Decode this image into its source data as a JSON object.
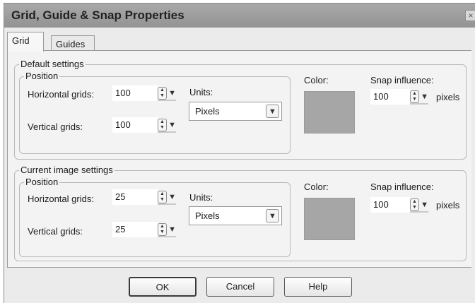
{
  "window": {
    "title": "Grid, Guide & Snap Properties",
    "close_glyph": "×"
  },
  "tabs": [
    {
      "label": "Grid",
      "active": true
    },
    {
      "label": "Guides",
      "active": false
    }
  ],
  "default_settings": {
    "group_label": "Default settings",
    "position_label": "Position",
    "horizontal_label": "Horizontal grids:",
    "horizontal_value": "100",
    "vertical_label": "Vertical grids:",
    "vertical_value": "100",
    "units_label": "Units:",
    "units_value": "Pixels",
    "color_label": "Color:",
    "color": "#a6a6a6",
    "snap_label": "Snap influence:",
    "snap_value": "100",
    "snap_unit": "pixels"
  },
  "current_settings": {
    "group_label": "Current image settings",
    "position_label": "Position",
    "horizontal_label": "Horizontal grids:",
    "horizontal_value": "25",
    "vertical_label": "Vertical grids:",
    "vertical_value": "25",
    "units_label": "Units:",
    "units_value": "Pixels",
    "color_label": "Color:",
    "color": "#a6a6a6",
    "snap_label": "Snap influence:",
    "snap_value": "100",
    "snap_unit": "pixels"
  },
  "buttons": {
    "ok": "OK",
    "cancel": "Cancel",
    "help": "Help"
  },
  "icons": {
    "spin": "spin-updown-icon",
    "dropdown": "chevron-down-icon"
  }
}
